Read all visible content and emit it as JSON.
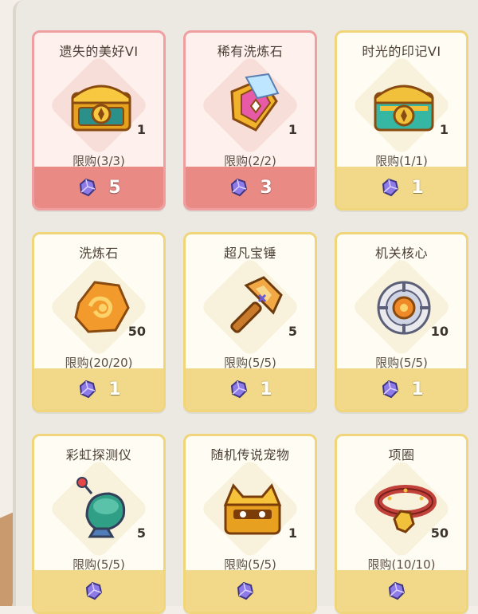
{
  "shop": {
    "items": [
      {
        "name": "遗失的美好VI",
        "count": "1",
        "limit": "限购(3/3)",
        "price": "5",
        "icon": "golden-chest-icon"
      },
      {
        "name": "稀有洗炼石",
        "count": "1",
        "limit": "限购(2/2)",
        "price": "3",
        "icon": "crystal-gem-icon"
      },
      {
        "name": "时光的印记VI",
        "count": "1",
        "limit": "限购(1/1)",
        "price": "1",
        "icon": "teal-chest-icon"
      },
      {
        "name": "洗炼石",
        "count": "50",
        "limit": "限购(20/20)",
        "price": "1",
        "icon": "orange-stone-icon"
      },
      {
        "name": "超凡宝锤",
        "count": "5",
        "limit": "限购(5/5)",
        "price": "1",
        "icon": "hammer-icon"
      },
      {
        "name": "机关核心",
        "count": "10",
        "limit": "限购(5/5)",
        "price": "1",
        "icon": "mechanism-core-icon"
      },
      {
        "name": "彩虹探测仪",
        "count": "5",
        "limit": "限购(5/5)",
        "price": "",
        "icon": "rainbow-detector-icon"
      },
      {
        "name": "随机传说宠物",
        "count": "1",
        "limit": "限购(5/5)",
        "price": "",
        "icon": "pet-chest-icon"
      },
      {
        "name": "项圈",
        "count": "50",
        "limit": "限购(10/10)",
        "price": "",
        "icon": "collar-icon"
      }
    ],
    "currency_icon": "purple-gem-icon",
    "colors": {
      "sold_out_border": "#ef9fa0",
      "sold_out_bar": "#e98b84",
      "normal_border": "#f0d57a",
      "normal_bar": "#f2d98a"
    }
  }
}
